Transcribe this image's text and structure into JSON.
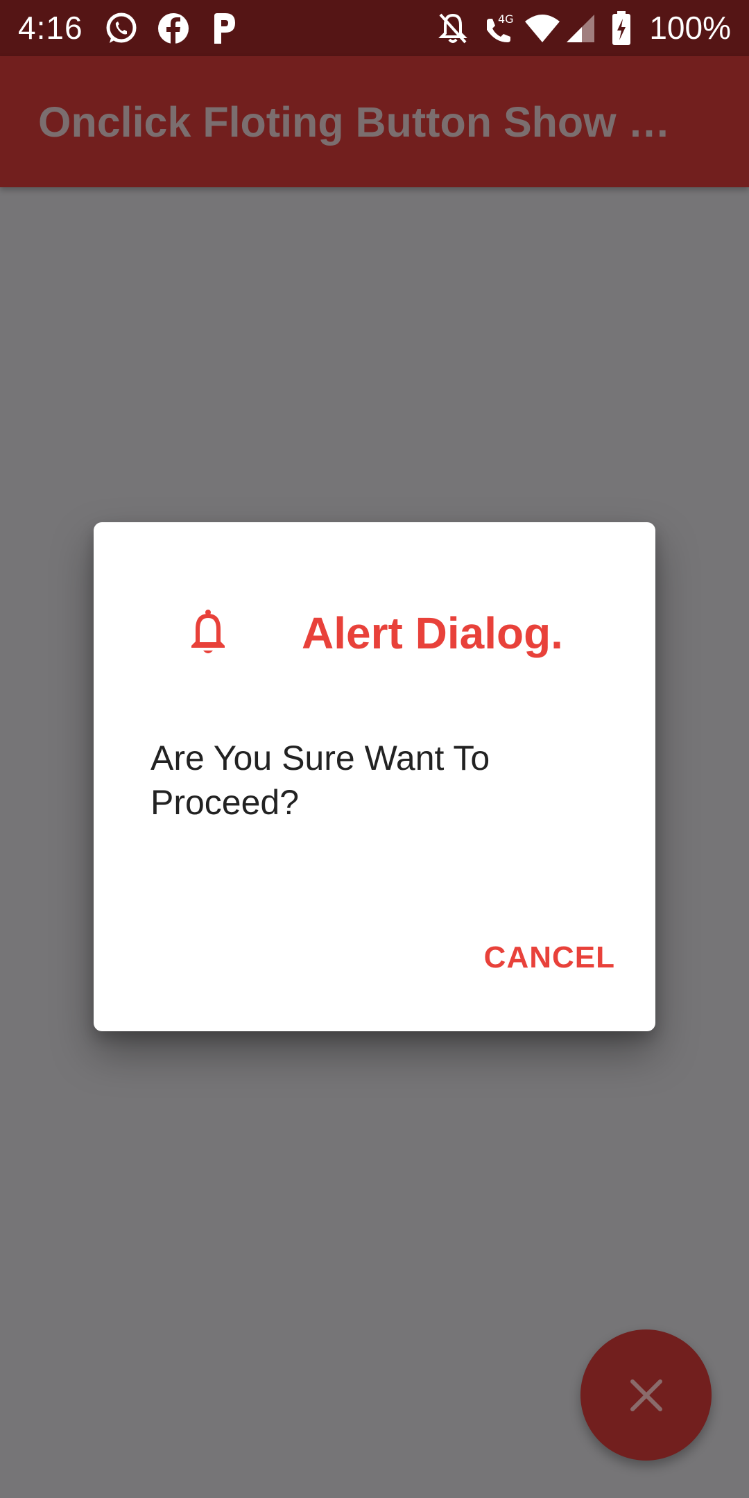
{
  "status_bar": {
    "time": "4:16",
    "battery_text": "100%",
    "icons": [
      "whatsapp-icon",
      "facebook-icon",
      "p-app-icon",
      "notifications-off-icon",
      "volte-4g-call-icon",
      "wifi-icon",
      "cellular-signal-icon",
      "battery-charging-icon"
    ]
  },
  "app_bar": {
    "title": "Onclick Floting Button Show …"
  },
  "dialog": {
    "icon": "bell-icon",
    "title": "Alert Dialog.",
    "message": "Are You Sure Want To Proceed?",
    "cancel_label": "CANCEL"
  },
  "fab": {
    "icon": "close-icon"
  },
  "colors": {
    "status_bar": "#551515",
    "app_bar": "#721f1e",
    "scrim": "#767577",
    "accent": "#e8413a",
    "fab": "#721f1e"
  }
}
